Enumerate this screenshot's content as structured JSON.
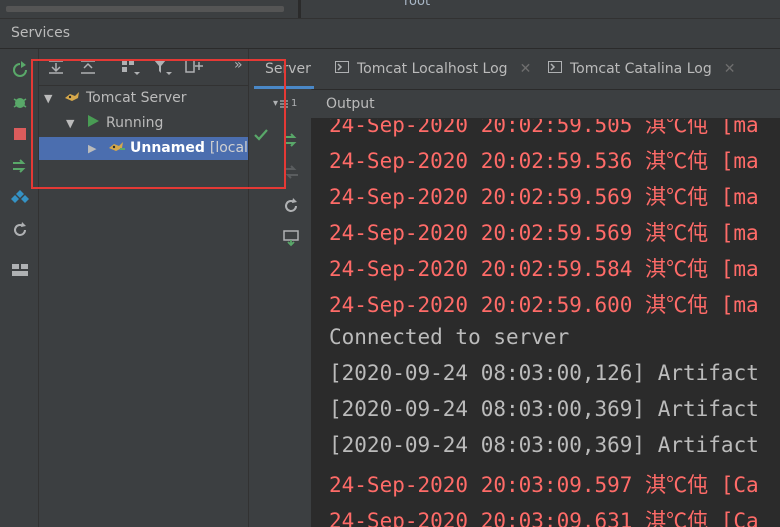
{
  "window": {
    "top_label": "root",
    "title": "Services"
  },
  "tree": {
    "items": [
      {
        "label": "Tomcat Server"
      },
      {
        "label": "Running"
      },
      {
        "label": "Unnamed",
        "suffix": "[local]"
      }
    ]
  },
  "tabs": [
    {
      "label": "Server",
      "active": true
    },
    {
      "label": "Tomcat Localhost Log",
      "closable": true
    },
    {
      "label": "Tomcat Catalina Log",
      "closable": true
    }
  ],
  "toolbar": {
    "layout_label": "1",
    "more_label": "»"
  },
  "output": {
    "header": "Output",
    "lines": [
      {
        "text": "24-Sep-2020 20:02:59.505 淇℃伅 [ma",
        "kind": "error"
      },
      {
        "text": "24-Sep-2020 20:02:59.536 淇℃伅 [ma",
        "kind": "error"
      },
      {
        "text": "24-Sep-2020 20:02:59.569 淇℃伅 [ma",
        "kind": "error"
      },
      {
        "text": "24-Sep-2020 20:02:59.569 淇℃伅 [ma",
        "kind": "error"
      },
      {
        "text": "24-Sep-2020 20:02:59.584 淇℃伅 [ma",
        "kind": "error"
      },
      {
        "text": "24-Sep-2020 20:02:59.600 淇℃伅 [ma",
        "kind": "error"
      },
      {
        "text": "Connected to server",
        "kind": "normal"
      },
      {
        "text": "[2020-09-24 08:03:00,126] Artifact",
        "kind": "normal"
      },
      {
        "text": "[2020-09-24 08:03:00,369] Artifact",
        "kind": "normal"
      },
      {
        "text": "[2020-09-24 08:03:00,369] Artifact",
        "kind": "normal"
      },
      {
        "text": "24-Sep-2020 20:03:09.597 淇℃伅 [Ca",
        "kind": "error"
      },
      {
        "text": "24-Sep-2020 20:03:09.631 淇℃伅 [Ca",
        "kind": "error"
      }
    ]
  },
  "colors": {
    "background": "#2b2b2b",
    "panel": "#3c3f41",
    "selection": "#4b6eaf",
    "log_red": "#ff6b68",
    "log_normal": "#bbbbbb",
    "run_green": "#499c54",
    "annotation_red": "#e53935"
  }
}
